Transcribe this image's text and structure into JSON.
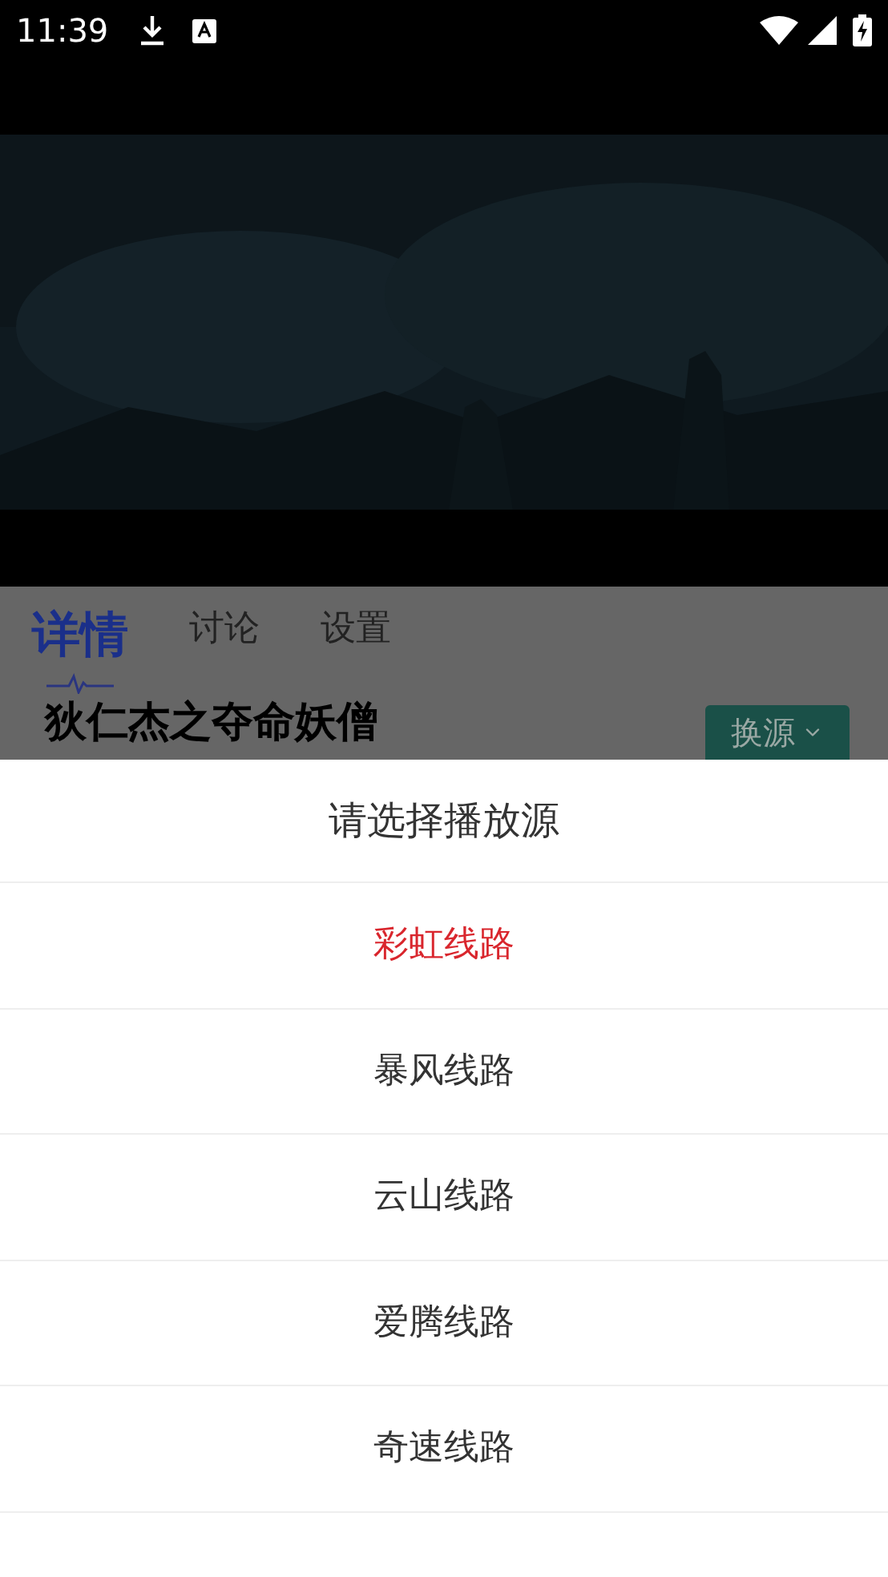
{
  "status_bar": {
    "time": "11:39"
  },
  "tabs": [
    {
      "label": "详情",
      "selected": true
    },
    {
      "label": "讨论",
      "selected": false
    },
    {
      "label": "设置",
      "selected": false
    }
  ],
  "title": "狄仁杰之夺命妖僧",
  "switch_source_button": "换源",
  "sheet": {
    "title": "请选择播放源",
    "items": [
      {
        "label": "彩虹线路",
        "selected": true
      },
      {
        "label": "暴风线路",
        "selected": false
      },
      {
        "label": "云山线路",
        "selected": false
      },
      {
        "label": "爱腾线路",
        "selected": false
      },
      {
        "label": "奇速线路",
        "selected": false
      }
    ]
  }
}
